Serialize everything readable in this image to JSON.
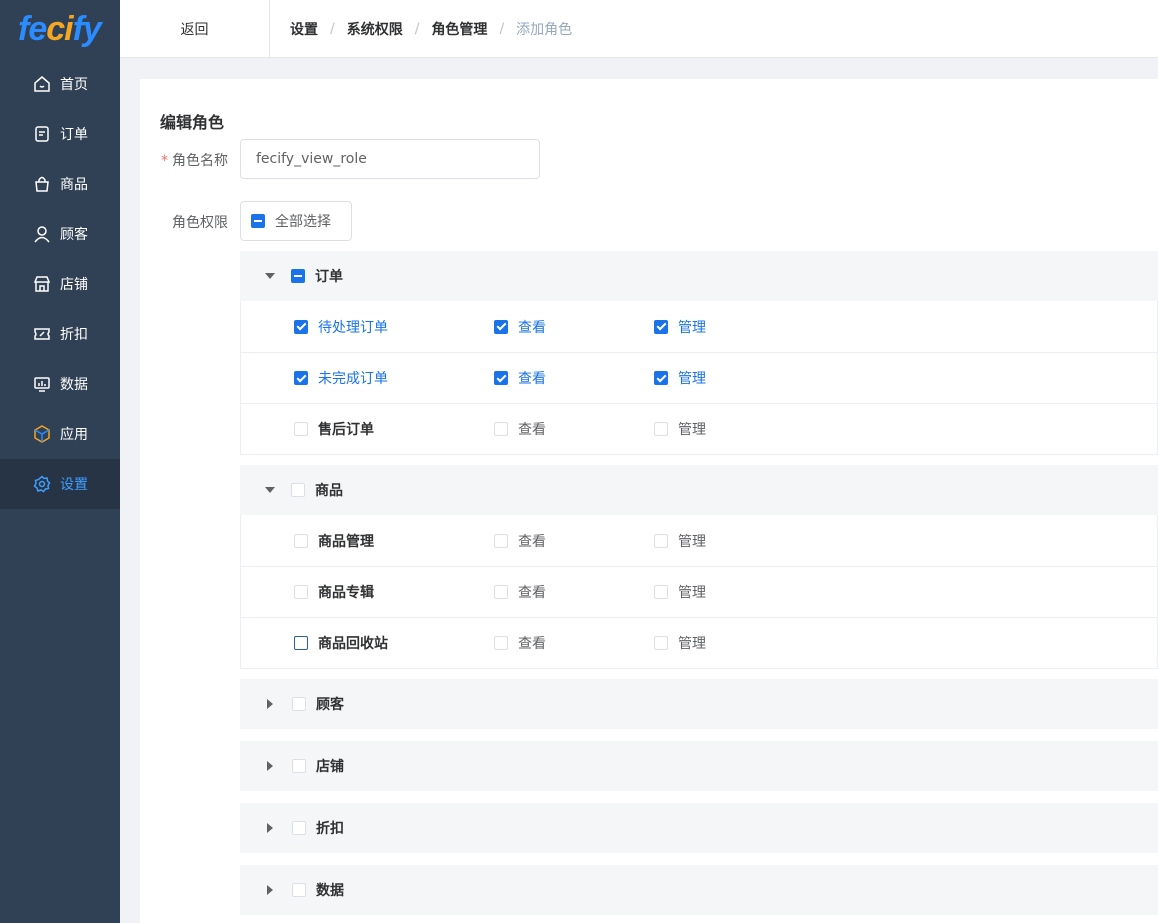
{
  "logo": {
    "part1": "fe",
    "part2": "ci",
    "part3": "fy"
  },
  "sidebar": {
    "items": [
      {
        "label": "首页",
        "icon": "home-icon"
      },
      {
        "label": "订单",
        "icon": "order-icon"
      },
      {
        "label": "商品",
        "icon": "bag-icon"
      },
      {
        "label": "顾客",
        "icon": "user-icon"
      },
      {
        "label": "店铺",
        "icon": "store-icon"
      },
      {
        "label": "折扣",
        "icon": "coupon-icon"
      },
      {
        "label": "数据",
        "icon": "chart-icon"
      },
      {
        "label": "应用",
        "icon": "cube-icon"
      },
      {
        "label": "设置",
        "icon": "gear-icon",
        "active": true
      }
    ]
  },
  "topbar": {
    "back_label": "返回",
    "breadcrumb": [
      "设置",
      "系统权限",
      "角色管理",
      "添加角色"
    ]
  },
  "form": {
    "title": "编辑角色",
    "required_mark": "*",
    "name_label": "角色名称",
    "name_value": "fecify_view_role",
    "perm_label": "角色权限",
    "select_all_label": "全部选择"
  },
  "groups": [
    {
      "title": "订单",
      "expanded": true,
      "state": "indeterminate",
      "rows": [
        {
          "name": "待处理订单",
          "view": "查看",
          "manage": "管理",
          "checked": true
        },
        {
          "name": "未完成订单",
          "view": "查看",
          "manage": "管理",
          "checked": true
        },
        {
          "name": "售后订单",
          "view": "查看",
          "manage": "管理",
          "checked": false
        }
      ]
    },
    {
      "title": "商品",
      "expanded": true,
      "state": "unchecked",
      "rows": [
        {
          "name": "商品管理",
          "view": "查看",
          "manage": "管理",
          "checked": false
        },
        {
          "name": "商品专辑",
          "view": "查看",
          "manage": "管理",
          "checked": false
        },
        {
          "name": "商品回收站",
          "view": "查看",
          "manage": "管理",
          "checked": false
        }
      ]
    },
    {
      "title": "顾客",
      "expanded": false,
      "state": "unchecked"
    },
    {
      "title": "店铺",
      "expanded": false,
      "state": "unchecked"
    },
    {
      "title": "折扣",
      "expanded": false,
      "state": "unchecked"
    },
    {
      "title": "数据",
      "expanded": false,
      "state": "unchecked"
    }
  ],
  "colors": {
    "sidebar_bg": "#304156",
    "accent": "#1a73e8",
    "active_bg": "#263445"
  }
}
